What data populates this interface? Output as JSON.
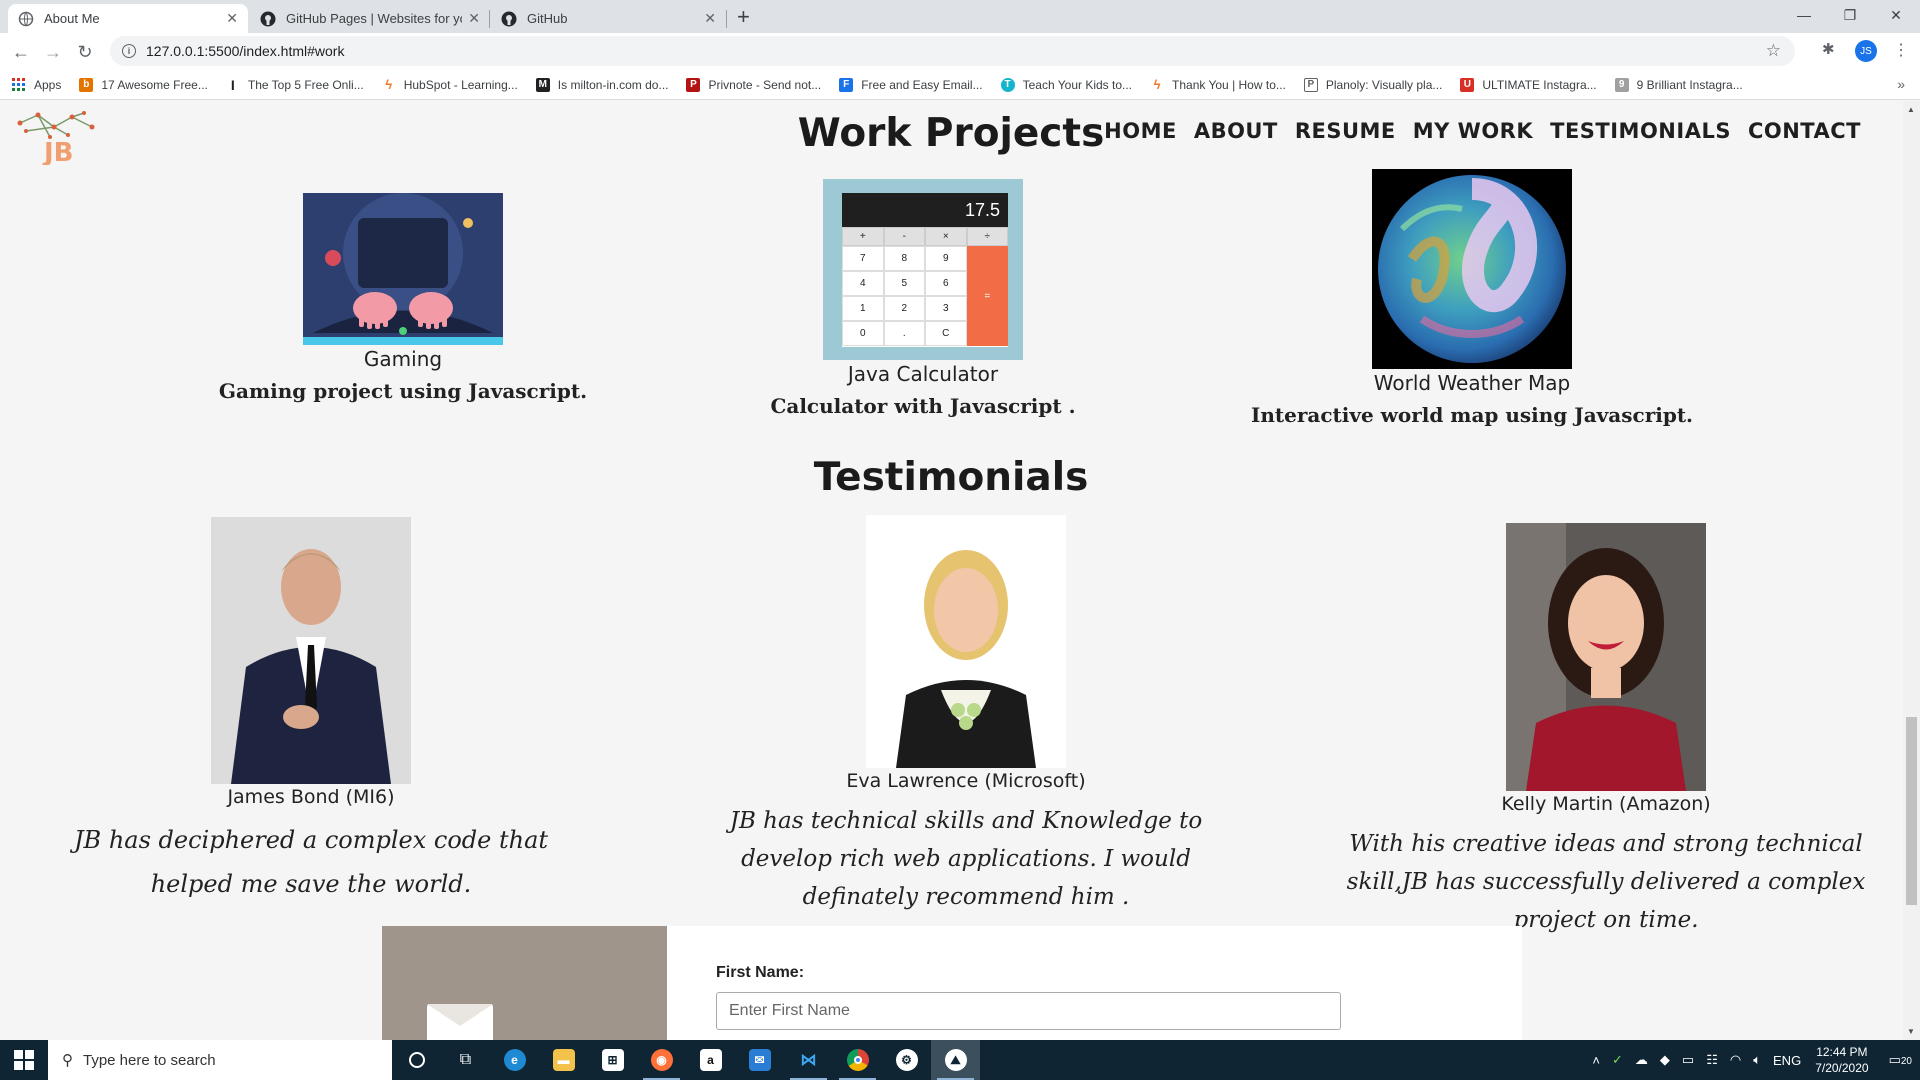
{
  "browser": {
    "tabs": [
      {
        "title": "About Me",
        "active": true
      },
      {
        "title": "GitHub Pages | Websites for you",
        "active": false
      },
      {
        "title": "GitHub",
        "active": false
      }
    ],
    "url": "127.0.0.1:5500/index.html#work",
    "bookmarks": [
      {
        "label": "Apps",
        "icon": "apps-grid-icon",
        "color": "#d93025"
      },
      {
        "label": "17 Awesome Free...",
        "icon": "b",
        "color": "#e37400"
      },
      {
        "label": "The Top 5 Free Onli...",
        "icon": "I",
        "color": "#202124"
      },
      {
        "label": "HubSpot - Learning...",
        "icon": "hubspot-icon",
        "color": "#f57722"
      },
      {
        "label": "Is milton-in.com do...",
        "icon": "M",
        "color": "#202124"
      },
      {
        "label": "Privnote - Send not...",
        "icon": "P",
        "color": "#b31412"
      },
      {
        "label": "Free and Easy Email...",
        "icon": "F",
        "color": "#1a73e8"
      },
      {
        "label": "Teach Your Kids to...",
        "icon": "T",
        "color": "#12b5cb"
      },
      {
        "label": "Thank You | How to...",
        "icon": "hubspot-icon",
        "color": "#f57722"
      },
      {
        "label": "Planoly: Visually pla...",
        "icon": "P",
        "color": "#5f6368"
      },
      {
        "label": "ULTIMATE Instagra...",
        "icon": "U",
        "color": "#d93025"
      },
      {
        "label": "9 Brilliant Instagra...",
        "icon": "9",
        "color": "#a0a0a0"
      }
    ],
    "profile_initials": "JS"
  },
  "site": {
    "logo_text": "JB",
    "nav": [
      "HOME",
      "ABOUT",
      "RESUME",
      "MY WORK",
      "TESTIMONIALS",
      "CONTACT"
    ],
    "work_title": "Work Projects",
    "projects": [
      {
        "name": "Gaming",
        "desc": "Gaming project using Javascript."
      },
      {
        "name": "Java Calculator",
        "desc": "Calculator with Javascript ."
      },
      {
        "name": "World Weather Map",
        "desc": "Interactive world map using Javascript."
      }
    ],
    "calculator": {
      "display": "17.5",
      "ops": [
        "+",
        "-",
        "×",
        "÷"
      ],
      "rows": [
        [
          "7",
          "8",
          "9"
        ],
        [
          "4",
          "5",
          "6"
        ],
        [
          "1",
          "2",
          "3"
        ],
        [
          "0",
          ".",
          "C"
        ]
      ],
      "equals": "="
    },
    "testimonials_title": "Testimonials",
    "testimonials": [
      {
        "name": "James Bond (MI6)",
        "quote": "JB has deciphered a complex code that helped me save the world."
      },
      {
        "name": "Eva Lawrence (Microsoft)",
        "quote": "JB has technical skills and Knowledge to develop rich web applications. I would definately recommend him ."
      },
      {
        "name": "Kelly Martin (Amazon)",
        "quote": "With his creative ideas and strong technical skill,JB has successfully delivered a complex project on time."
      }
    ],
    "contact": {
      "first_name_label": "First Name:",
      "first_name_placeholder": "Enter First Name"
    }
  },
  "taskbar": {
    "search_placeholder": "Type here to search",
    "apps": [
      "cortana-icon",
      "task-view-icon",
      "edge-icon",
      "file-explorer-icon",
      "store-icon",
      "firefox-icon",
      "amazon-icon",
      "mail-icon",
      "vscode-icon",
      "chrome-icon",
      "git-icon",
      "photos-icon"
    ],
    "lang": "ENG",
    "time": "12:44 PM",
    "date": "7/20/2020",
    "notifications": "20"
  }
}
